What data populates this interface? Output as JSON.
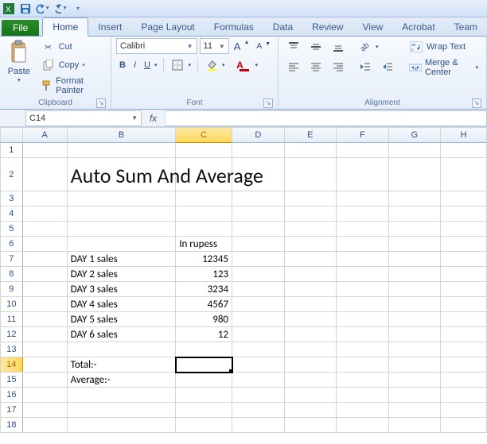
{
  "qat": {
    "save_title": "Save",
    "undo_title": "Undo",
    "redo_title": "Redo"
  },
  "tabs": {
    "file": "File",
    "items": [
      "Home",
      "Insert",
      "Page Layout",
      "Formulas",
      "Data",
      "Review",
      "View",
      "Acrobat",
      "Team"
    ],
    "active": 0
  },
  "ribbon": {
    "clipboard": {
      "label": "Clipboard",
      "paste": "Paste",
      "cut": "Cut",
      "copy": "Copy",
      "format_painter": "Format Painter"
    },
    "font": {
      "label": "Font",
      "font_name": "Calibri",
      "font_size": "11",
      "bold": "B",
      "italic": "I",
      "underline": "U"
    },
    "alignment": {
      "label": "Alignment",
      "wrap": "Wrap Text",
      "merge": "Merge & Center"
    }
  },
  "formula_bar": {
    "cell_ref": "C14",
    "fx": "fx",
    "formula": ""
  },
  "columns": [
    "A",
    "B",
    "C",
    "D",
    "E",
    "F",
    "G",
    "H"
  ],
  "rows": [
    1,
    2,
    3,
    4,
    5,
    6,
    7,
    8,
    9,
    10,
    11,
    12,
    13,
    14,
    15,
    16,
    17,
    18
  ],
  "selected": {
    "col": "C",
    "row": 14
  },
  "cells": {
    "B2": "Auto Sum And Average",
    "C6": "In rupess",
    "B7": "DAY 1 sales",
    "C7": "12345",
    "B8": "DAY 2 sales",
    "C8": "123",
    "B9": "DAY 3 sales",
    "C9": "3234",
    "B10": "DAY 4 sales",
    "C10": "4567",
    "B11": "DAY 5 sales",
    "C11": "980",
    "B12": "DAY 6 sales",
    "C12": "12",
    "B14": "Total:-",
    "B15": "Average:-"
  }
}
